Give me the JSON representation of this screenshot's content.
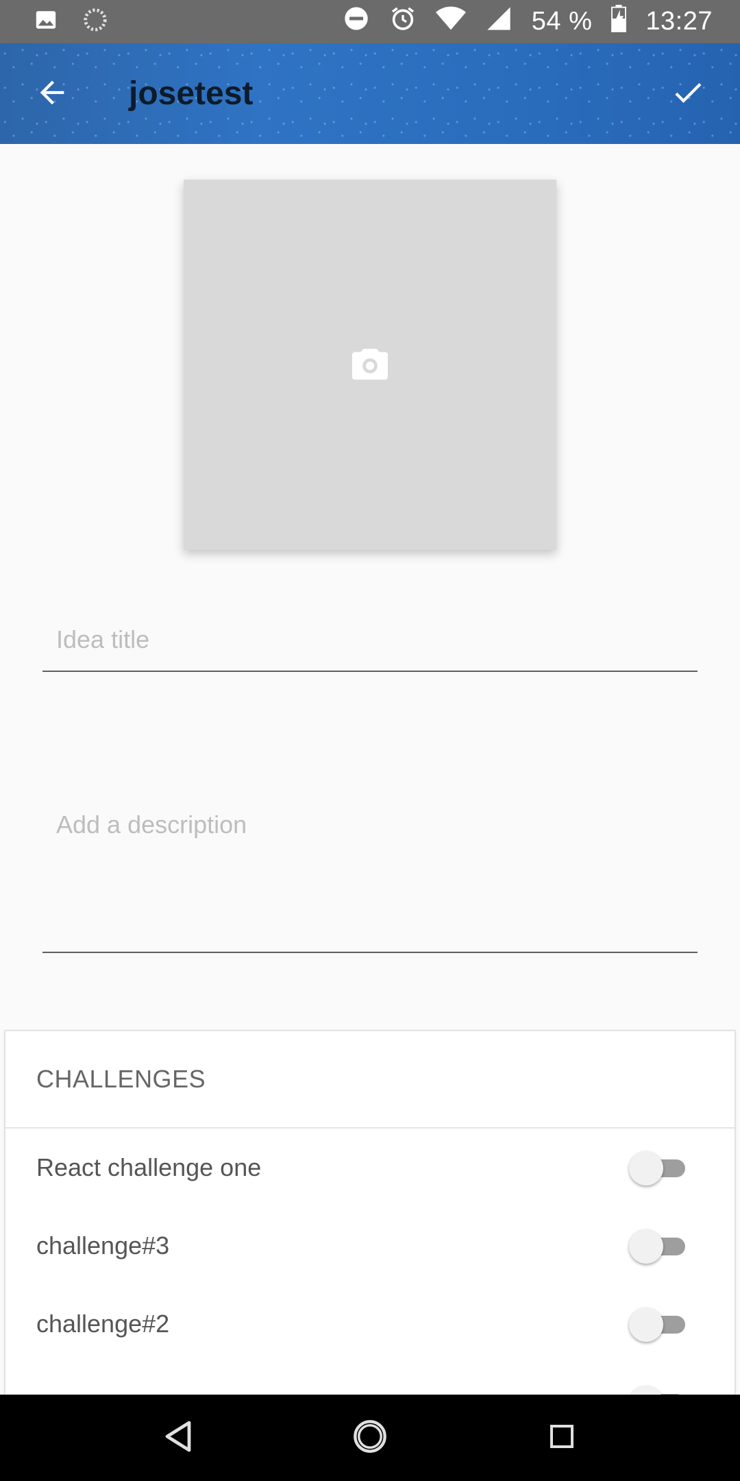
{
  "status_bar": {
    "battery": "54 %",
    "time": "13:27",
    "icons": [
      "image-icon",
      "loading-icon",
      "do-not-disturb-icon",
      "alarm-icon",
      "wifi-icon",
      "signal-icon",
      "battery-icon"
    ]
  },
  "app_bar": {
    "title": "josetest",
    "back_icon": "arrow-back-icon",
    "confirm_icon": "check-icon"
  },
  "image_picker": {
    "icon": "camera-icon"
  },
  "form": {
    "title_placeholder": "Idea title",
    "description_placeholder": "Add a description"
  },
  "challenges": {
    "header": "CHALLENGES",
    "items": [
      {
        "label": "React challenge one",
        "enabled": false
      },
      {
        "label": "challenge#3",
        "enabled": false
      },
      {
        "label": "challenge#2",
        "enabled": false
      }
    ]
  },
  "nav_bar": {
    "icons": [
      "nav-back-icon",
      "nav-home-icon",
      "nav-recents-icon"
    ]
  },
  "colors": {
    "app_bar": "#2f73c4",
    "background": "#fafafa",
    "placeholder_box": "#d9d9d9"
  }
}
